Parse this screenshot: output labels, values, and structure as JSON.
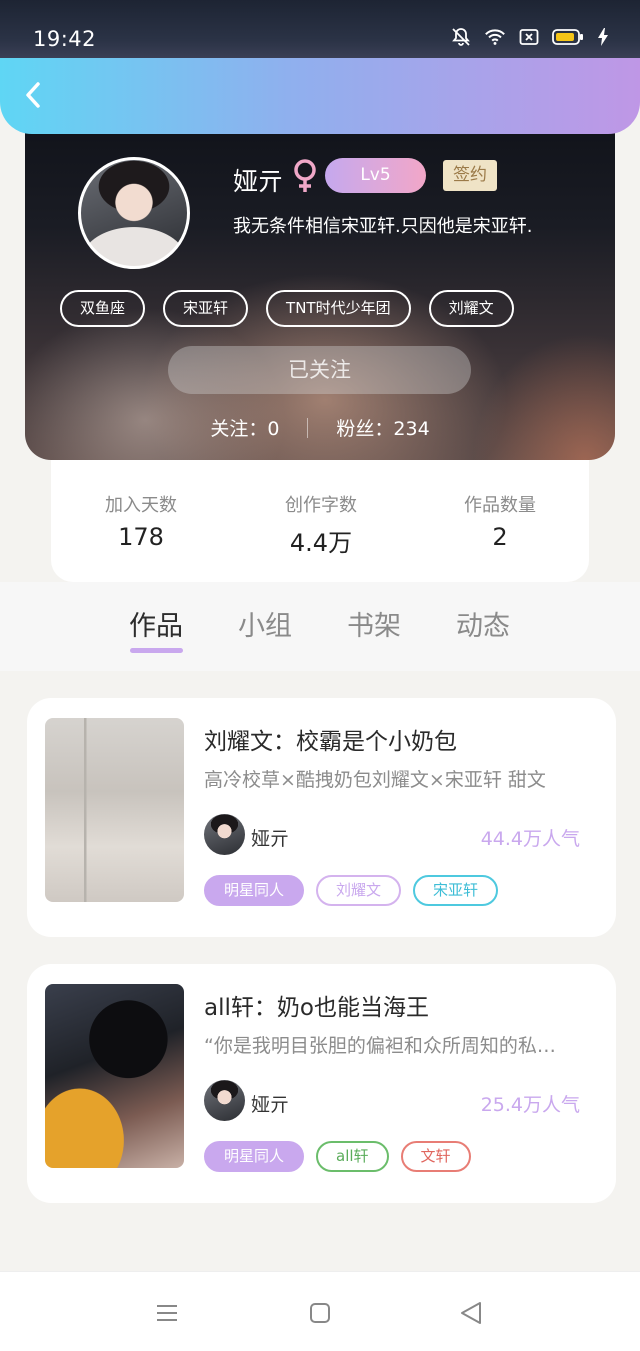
{
  "status_bar": {
    "time": "19:42",
    "icons": [
      "bell-muted-icon",
      "wifi-icon",
      "close-box-icon",
      "battery-icon",
      "charging-icon"
    ]
  },
  "header": {
    "back_icon": "chevron-left-icon",
    "gradient_colors": [
      "#5fd6f4",
      "#bf97e6"
    ]
  },
  "profile": {
    "name": "娅亓",
    "gender_symbol": "♀",
    "level": "Lv5",
    "signed_badge": "签约",
    "bio": "我无条件相信宋亚轩.只因他是宋亚轩.",
    "tags": [
      "双鱼座",
      "宋亚轩",
      "TNT时代少年团",
      "刘耀文"
    ],
    "follow_button": "已关注",
    "following_label": "关注：0",
    "fans_label": "粉丝：234"
  },
  "stats": [
    {
      "label": "加入天数",
      "value": "178"
    },
    {
      "label": "创作字数",
      "value": "4.4万"
    },
    {
      "label": "作品数量",
      "value": "2"
    }
  ],
  "tabs": [
    {
      "label": "作品",
      "active": true
    },
    {
      "label": "小组",
      "active": false
    },
    {
      "label": "书架",
      "active": false
    },
    {
      "label": "动态",
      "active": false
    }
  ],
  "works": [
    {
      "title": "刘耀文：校霸是个小奶包",
      "description": "高冷校草×酷拽奶包刘耀文×宋亚轩 甜文",
      "author": "娅亓",
      "popularity": "44.4万人气",
      "chips": [
        {
          "label": "明星同人",
          "color": "#c9a8ee",
          "filled": true
        },
        {
          "label": "刘耀文",
          "color": "#d4b3ee",
          "filled": false
        },
        {
          "label": "宋亚轩",
          "color": "#4ec9df",
          "filled": false
        }
      ]
    },
    {
      "title": "all轩：奶o也能当海王",
      "description": "“你是我明目张胆的偏袒和众所周知的私…",
      "author": "娅亓",
      "popularity": "25.4万人气",
      "chips": [
        {
          "label": "明星同人",
          "color": "#c9a8ee",
          "filled": true
        },
        {
          "label": "all轩",
          "color": "#6bbd6b",
          "filled": false
        },
        {
          "label": "文轩",
          "color": "#e87d75",
          "filled": false
        }
      ]
    }
  ],
  "bottom_nav": [
    "menu-icon",
    "home-square-icon",
    "back-triangle-icon"
  ],
  "colors": {
    "accent_purple": "#c9a8ee",
    "popularity": "#c9a8ee",
    "page_bg": "#f4f3f0"
  }
}
